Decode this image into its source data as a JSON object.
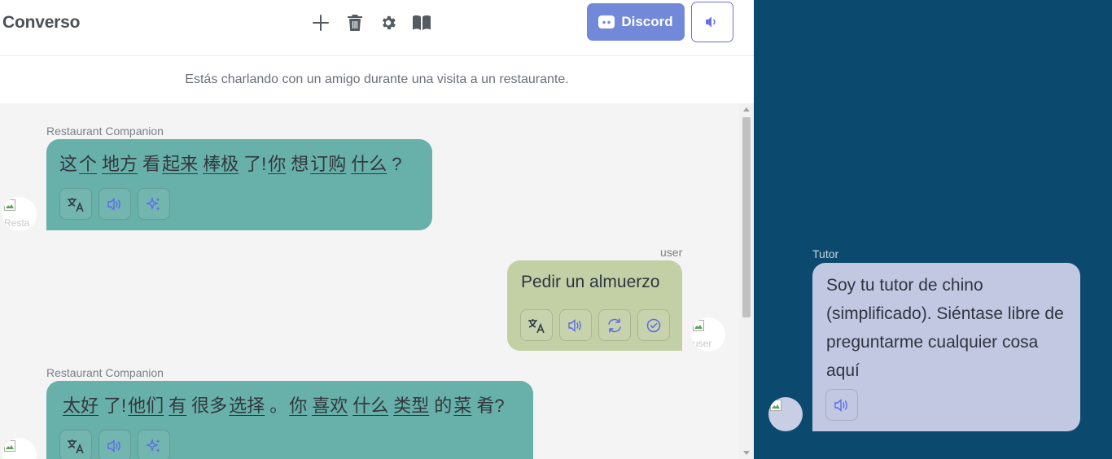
{
  "app": {
    "title": "Converso"
  },
  "header": {
    "icons": [
      "plus-icon",
      "trash-icon",
      "gear-icon",
      "book-icon"
    ],
    "discord_label": "Discord",
    "discord_color": "#7289da",
    "accent_color": "#6a70e0"
  },
  "scenario": {
    "text": "Estás charlando con un amigo durante una visita a un restaurante."
  },
  "messages": [
    {
      "sender": "Restaurant Companion",
      "tokens": [
        {
          "t": "这",
          "u": false
        },
        {
          "t": "个",
          "u": true
        },
        {
          "t": "地方",
          "u": true
        },
        {
          "t": "看",
          "u": false
        },
        {
          "t": "起来",
          "u": true
        },
        {
          "t": "棒极",
          "u": true
        },
        {
          "t": "了!",
          "u": false
        },
        {
          "t": "你",
          "u": true
        },
        {
          "t": "想",
          "u": false
        },
        {
          "t": "订购",
          "u": true
        },
        {
          "t": "什么",
          "u": true
        },
        {
          "t": "?",
          "u": false
        }
      ],
      "actions": [
        "translate-icon",
        "speaker-icon",
        "sparkle-icon"
      ],
      "avatar_alt": "Resta"
    },
    {
      "sender": "user",
      "text": "Pedir un almuerzo",
      "actions": [
        "translate-icon",
        "speaker-icon",
        "refresh-icon",
        "check-circle-icon"
      ],
      "avatar_alt": "user"
    },
    {
      "sender": "Restaurant Companion",
      "tokens": [
        {
          "t": "太好",
          "u": true
        },
        {
          "t": "了!",
          "u": false
        },
        {
          "t": "他们",
          "u": true
        },
        {
          "t": "有",
          "u": true
        },
        {
          "t": "很多",
          "u": false
        },
        {
          "t": "选择",
          "u": true
        },
        {
          "t": "。",
          "u": false
        },
        {
          "t": "你",
          "u": true
        },
        {
          "t": "喜欢",
          "u": true
        },
        {
          "t": "什么",
          "u": true
        },
        {
          "t": "类型",
          "u": true
        },
        {
          "t": "的",
          "u": false
        },
        {
          "t": "菜",
          "u": true
        },
        {
          "t": "肴?",
          "u": false
        }
      ],
      "actions": [
        "translate-icon",
        "speaker-icon",
        "sparkle-icon"
      ],
      "avatar_alt": ""
    }
  ],
  "tutor": {
    "sender": "Tutor",
    "text": "Soy tu tutor de chino (simplificado). Siéntase libre de preguntarme cualquier cosa aquí",
    "action": "speaker-icon"
  },
  "colors": {
    "companion_bubble": "#68b0aa",
    "user_bubble": "#c3d0a5",
    "tutor_pane": "#0b4a6e",
    "tutor_bubble": "#c2c8e2"
  }
}
